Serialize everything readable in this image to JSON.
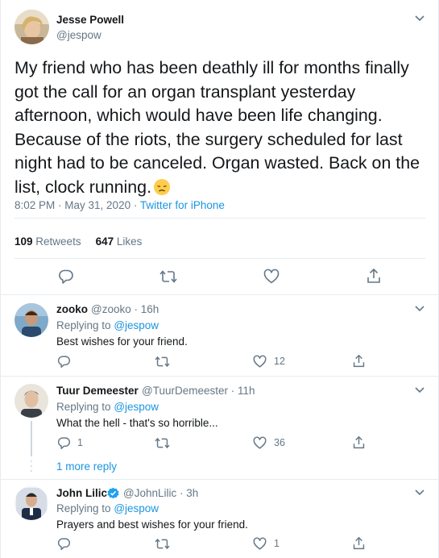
{
  "main_tweet": {
    "author_name": "Jesse Powell",
    "author_handle": "@jespow",
    "text": "My friend who has been deathly ill for months finally got the call for an organ transplant yesterday afternoon, which would have been life changing. Because of the riots, the surgery scheduled for last night had to be canceled. Organ wasted. Back on the list, clock running.",
    "emoji_icon": "disappointed-face-emoji",
    "time": "8:02 PM",
    "separator": " · ",
    "date": "May 31, 2020",
    "source": "Twitter for iPhone",
    "retweets_count": "109",
    "retweets_label": "Retweets",
    "likes_count": "647",
    "likes_label": "Likes"
  },
  "replies": [
    {
      "author_name": "zooko",
      "author_handle": "@zooko",
      "age": "16h",
      "replying_prefix": "Replying to",
      "replying_to": "@jespow",
      "text": "Best wishes for your friend.",
      "reply_count": "",
      "like_count": "12"
    },
    {
      "author_name": "Tuur Demeester",
      "author_handle": "@TuurDemeester",
      "age": "11h",
      "replying_prefix": "Replying to",
      "replying_to": "@jespow",
      "text": "What the hell - that's so horrible...",
      "reply_count": "1",
      "like_count": "36",
      "more_replies": "1 more reply"
    },
    {
      "author_name": "John Lilic",
      "author_handle": "@JohnLilic",
      "age": "3h",
      "replying_prefix": "Replying to",
      "replying_to": "@jespow",
      "text": "Prayers and best wishes for your friend.",
      "reply_count": "",
      "like_count": "1",
      "verified": true
    }
  ],
  "colors": {
    "link": "#1b95e0",
    "secondary_text": "#657786",
    "primary_text": "#14171a",
    "divider": "#e6ecf0"
  },
  "separator": " · "
}
